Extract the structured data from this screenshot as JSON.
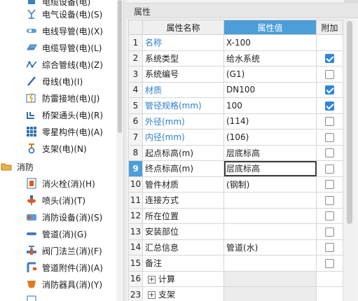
{
  "tree": {
    "items": [
      {
        "label": "电缆设备(电)",
        "icon": "cable-equipment-icon",
        "y": -10
      },
      {
        "label": "电气设备(电)(S)",
        "icon": "electrical-equipment-icon"
      },
      {
        "label": "电线导管(电)(X)",
        "icon": "wire-conduit-icon"
      },
      {
        "label": "电缆导管(电)(L)",
        "icon": "cable-conduit-icon"
      },
      {
        "label": "综合管线(电)(Z)",
        "icon": "combined-pipeline-icon"
      },
      {
        "label": "母线(电)(I)",
        "icon": "busbar-icon"
      },
      {
        "label": "防雷接地(电)(J)",
        "icon": "lightning-grounding-icon"
      },
      {
        "label": "桥架通头(电)(R)",
        "icon": "bridge-fitting-icon"
      },
      {
        "label": "零星构件(电)(A)",
        "icon": "misc-component-icon"
      },
      {
        "label": "支架(电)(N)",
        "icon": "bracket-icon"
      }
    ],
    "category": {
      "label": "消防",
      "icon": "folder-icon"
    },
    "fire_items": [
      {
        "label": "消火栓(消)(H)",
        "icon": "hydrant-icon"
      },
      {
        "label": "喷头(消)(T)",
        "icon": "sprinkler-icon"
      },
      {
        "label": "消防设备(消)(S)",
        "icon": "fire-equipment-icon"
      },
      {
        "label": "管道(消)(G)",
        "icon": "pipe-icon"
      },
      {
        "label": "阀门法兰(消)(F)",
        "icon": "valve-flange-icon"
      },
      {
        "label": "管道附件(消)(A)",
        "icon": "pipe-accessory-icon"
      },
      {
        "label": "消防器具(消)(Y)",
        "icon": "fire-appliance-icon"
      }
    ]
  },
  "panel": {
    "title": "属性",
    "headers": {
      "name": "属性名称",
      "value": "属性值",
      "extra": "附加"
    },
    "rows": [
      {
        "num": "1",
        "name": "名称",
        "value": "X-100",
        "blue": true,
        "check": null
      },
      {
        "num": "2",
        "name": "系统类型",
        "value": "给水系统",
        "blue": false,
        "check": true
      },
      {
        "num": "3",
        "name": "系统编号",
        "value": "(G1)",
        "blue": false,
        "check": false
      },
      {
        "num": "4",
        "name": "材质",
        "value": "DN100",
        "blue": true,
        "check": true
      },
      {
        "num": "5",
        "name": "管径规格(mm)",
        "value": "100",
        "blue": true,
        "check": true
      },
      {
        "num": "6",
        "name": "外径(mm)",
        "value": "(114)",
        "blue": true,
        "check": false
      },
      {
        "num": "7",
        "name": "内径(mm)",
        "value": "(106)",
        "blue": true,
        "check": false
      },
      {
        "num": "8",
        "name": "起点标高(m)",
        "value": "层底标高",
        "blue": false,
        "check": false
      },
      {
        "num": "9",
        "name": "终点标高(m)",
        "value": "层底标高",
        "blue": false,
        "check": false,
        "current": true
      },
      {
        "num": "10",
        "name": "管件材质",
        "value": "(钢制)",
        "blue": false,
        "check": false
      },
      {
        "num": "11",
        "name": "连接方式",
        "value": "",
        "blue": false,
        "check": false
      },
      {
        "num": "12",
        "name": "所在位置",
        "value": "",
        "blue": false,
        "check": false
      },
      {
        "num": "13",
        "name": "安装部位",
        "value": "",
        "blue": false,
        "check": false
      },
      {
        "num": "14",
        "name": "汇总信息",
        "value": "管道(水)",
        "blue": false,
        "check": false
      },
      {
        "num": "15",
        "name": "备注",
        "value": "",
        "blue": false,
        "check": false
      },
      {
        "num": "16",
        "name": "计算",
        "value": "",
        "blue": false,
        "check": null,
        "group": true
      },
      {
        "num": "23",
        "name": "支架",
        "value": "",
        "blue": false,
        "check": null,
        "group": true
      }
    ],
    "expand_symbol": "+"
  },
  "colors": {
    "selection": "#4c9ed9",
    "blue_text": "#2d7fd0",
    "checkbox": "#2f86d8",
    "fire_red": "#e05a1b"
  }
}
